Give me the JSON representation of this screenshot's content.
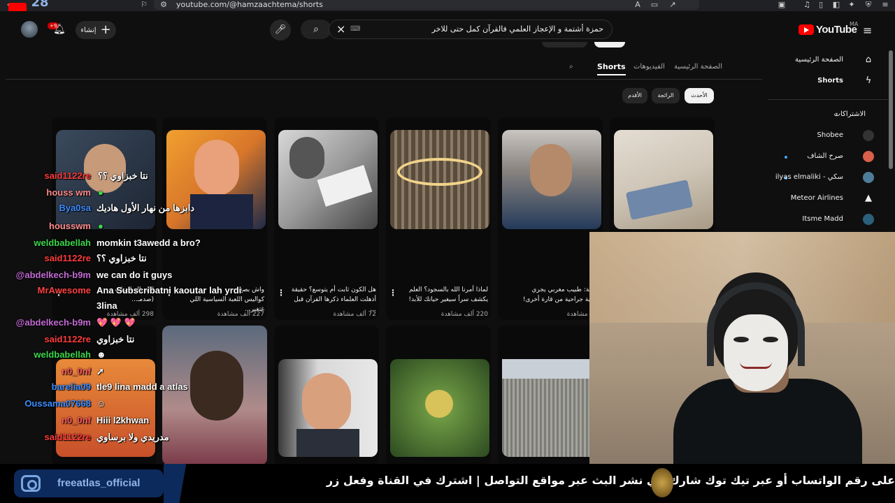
{
  "browser": {
    "url": "youtube.com/@hamzaachtema/shorts",
    "corner_number": "28"
  },
  "header": {
    "logo_text": "YouTube",
    "region": "MA",
    "search_query": "حمزة أشتمة و الإعجاز العلمي فالقرآن كمل حتى للاخر",
    "create_label": "إنشاء",
    "notifications_count": "+9"
  },
  "tabs": {
    "home": "الصفحة الرئيسية",
    "videos": "الفيديوهات",
    "shorts": "Shorts"
  },
  "chips": {
    "latest": "الأحدث",
    "popular": "الرائجة",
    "oldest": "الأقدم"
  },
  "sidebar": {
    "home": "الصفحة الرئيسية",
    "shorts": "Shorts",
    "subscriptions": "الاشتراكات",
    "subs": [
      {
        "label": "Shobee"
      },
      {
        "label": "صرح الشاف"
      },
      {
        "label": "ilyas elmaliki - سكي"
      },
      {
        "label": "Meteor Airlines"
      },
      {
        "label": "Itsme Madd"
      }
    ]
  },
  "shorts_row1": [
    {
      "title": "طبيبة: طبيب مغربي يجري\nعملية جراحية من قارة أخرى!",
      "views": "ألف مشاهدة"
    },
    {
      "title": "لماذا أمرنا الله بالسجود؟ العلم\nيكشف سراً سيغير حياتك للأبد!",
      "views": "220 ألف مشاهدة"
    },
    {
      "title": "هل الكون ثابت أم يتوسع؟ حقيقة\nأذهلت العلماء ذكرها القرآن قبل ...",
      "views": "72 ألف مشاهدة"
    },
    {
      "title": "واش بصح\nكواليس اللعبة السياسية اللي غتغير...",
      "views": "227 ألف مشاهدة"
    },
    {
      "title": "الله بالرياضيات\n(صدمـ...",
      "views": "298 ألف مشاهدة"
    }
  ],
  "chat": [
    {
      "user": "said1122re",
      "msg": "نتا خبزاوي ؟؟",
      "color": "#ff3b3b"
    },
    {
      "user": "houss wm",
      "msg": "",
      "color": "#ff8c8c"
    },
    {
      "user": "Bya0sa",
      "msg": "دابزها من نهار الأول هاديك",
      "color": "#3c8dff"
    },
    {
      "user": "housswm",
      "msg": "",
      "color": "#ff8c8c"
    },
    {
      "user": "weldbabellah",
      "msg": "momkin t3awedd a bro?",
      "color": "#3cd64a"
    },
    {
      "user": "said1122re",
      "msg": "نتا خبزاوي ؟؟",
      "color": "#ff3b3b"
    },
    {
      "user": "@abdelkech-b9m",
      "msg": "we can do it guys",
      "color": "#c46ad6"
    },
    {
      "user": "MrAwesome",
      "msg": "Ana Subscribatni kaoutar lah yrdi",
      "color": "#ff4040"
    },
    {
      "user": "",
      "msg": "3lina",
      "color": "#ffffff"
    },
    {
      "user": "@abdelkech-b9m",
      "msg": "💖 💖 💖",
      "color": "#c46ad6"
    },
    {
      "user": "said1122re",
      "msg": "نتا خبزاوي",
      "color": "#ff3b3b"
    },
    {
      "user": "weldbabellah",
      "msg": "",
      "color": "#3cd64a"
    },
    {
      "user": "n0_0nf",
      "msg": "",
      "color": "#ff5c5c"
    },
    {
      "user": "barelia09",
      "msg": "tle9 lina madd a atlas",
      "color": "#3c8dff"
    },
    {
      "user": "Oussama07668",
      "msg": "",
      "color": "#3c8dff"
    },
    {
      "user": "n0_0nf",
      "msg": "Hiii l2khwan",
      "color": "#ff5c5c"
    },
    {
      "user": "said1122re",
      "msg": "مدريدي ولا برساوي",
      "color": "#ff3b3b"
    }
  ],
  "bottom": {
    "instagram": "freeatlas_official",
    "ticker": "على رقم الواتساب أو عبر تيك توك        شارك في نشر البث عبر مواقع التواصل   |   اشترك في القناة وفعل زر"
  },
  "colors": {
    "accent_red": "#ff0000",
    "background": "#0f0f0f"
  }
}
